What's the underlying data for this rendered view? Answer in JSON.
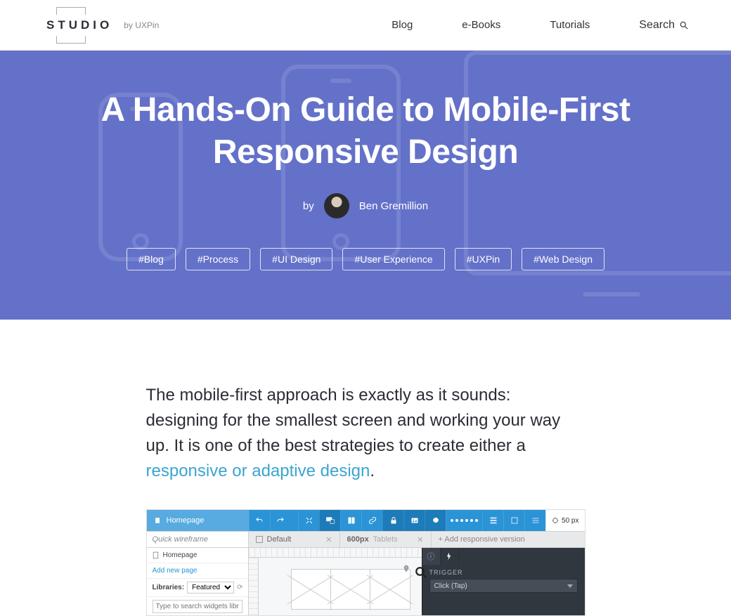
{
  "header": {
    "logo": "STUDIO",
    "logo_by": "by UXPin",
    "nav": {
      "blog": "Blog",
      "ebooks": "e-Books",
      "tutorials": "Tutorials",
      "search": "Search"
    }
  },
  "hero": {
    "title_line1": "A Hands-On Guide to Mobile-First",
    "title_line2": "Responsive Design",
    "by": "by",
    "author": "Ben Gremillion",
    "tags": [
      "#Blog",
      "#Process",
      "#UI Design",
      "#User Experience",
      "#UXPin",
      "#Web Design"
    ]
  },
  "article": {
    "intro_pre": "The mobile-first approach is exactly as it sounds: designing for the smallest screen and working your way up. It is one of the best strategies to create either a ",
    "intro_link": "responsive or adaptive design",
    "intro_post": "."
  },
  "tool": {
    "breadcrumb": "Homepage",
    "quick_wireframe": "Quick wireframe",
    "breakpoints": {
      "default": "Default",
      "bp600_px": "600px",
      "bp600_label": "Tablets",
      "add": "+ Add responsive version"
    },
    "sidebar": {
      "homepage": "Homepage",
      "add_page": "Add new page",
      "libraries_label": "Libraries:",
      "libraries_selected": "Featured",
      "search_placeholder": "Type to search widgets library"
    },
    "zoom": "50 px",
    "inspector": {
      "trigger_label": "TRIGGER",
      "trigger_value": "Click (Tap)"
    }
  }
}
